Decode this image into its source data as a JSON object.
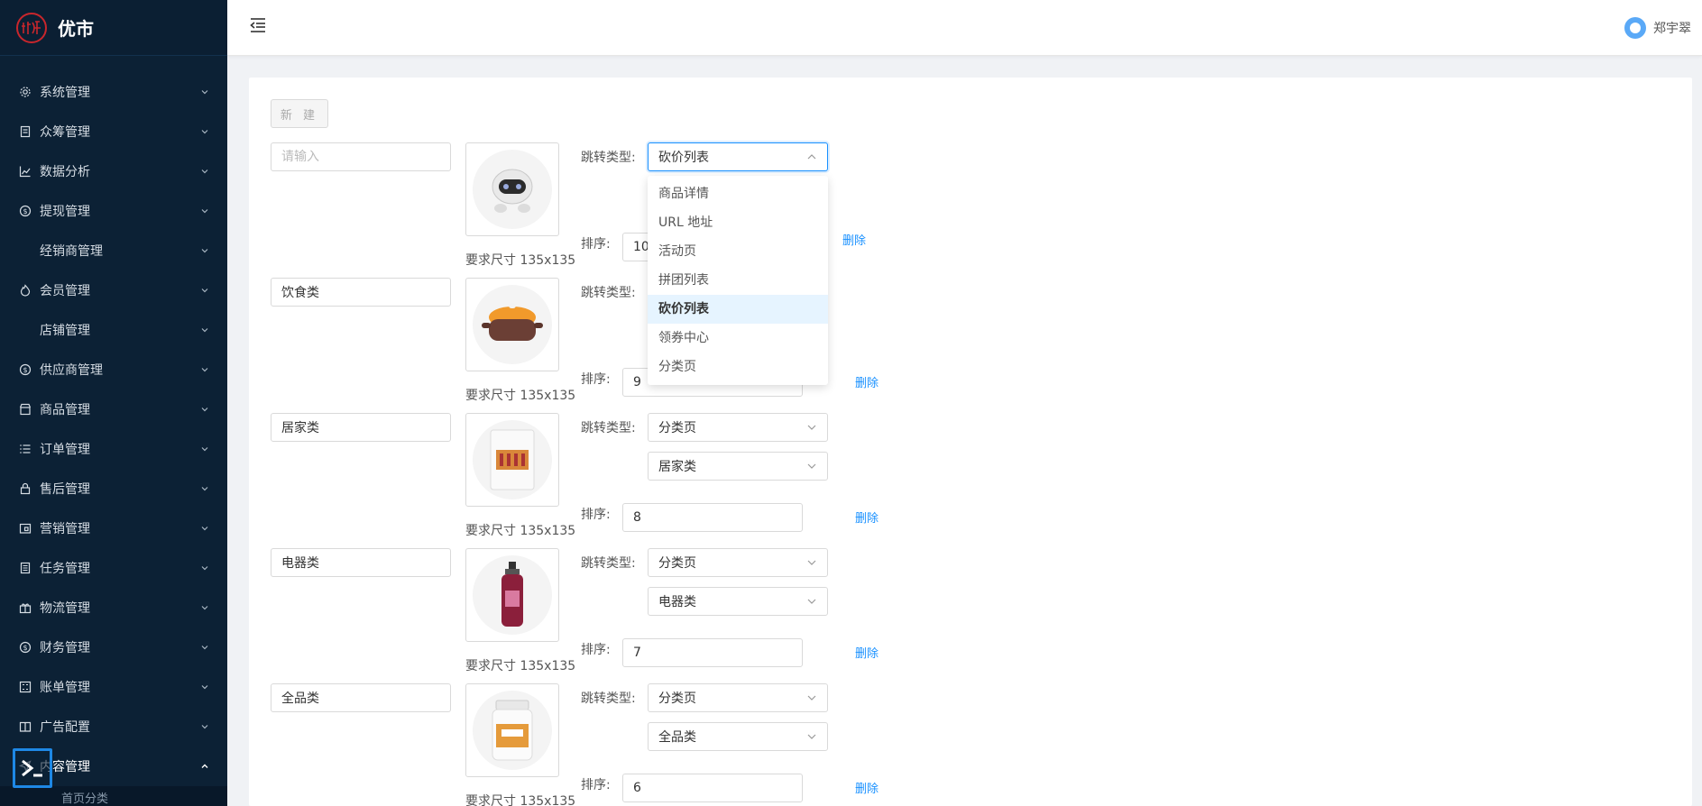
{
  "app": {
    "logo_text": "优市",
    "logo_mark": "优市"
  },
  "header": {
    "user_name": "郑宇翠"
  },
  "sidebar": {
    "items": [
      {
        "label": "系统管理",
        "icon": "gear-icon",
        "has_icon": true
      },
      {
        "label": "众筹管理",
        "icon": "clipboard-icon",
        "has_icon": true
      },
      {
        "label": "数据分析",
        "icon": "line-chart-icon",
        "has_icon": true
      },
      {
        "label": "提现管理",
        "icon": "coin-icon",
        "has_icon": true
      },
      {
        "label": "经销商管理",
        "icon": "",
        "has_icon": false
      },
      {
        "label": "会员管理",
        "icon": "fire-icon",
        "has_icon": true
      },
      {
        "label": "店铺管理",
        "icon": "",
        "has_icon": false
      },
      {
        "label": "供应商管理",
        "icon": "coin-icon",
        "has_icon": true
      },
      {
        "label": "商品管理",
        "icon": "shop-icon",
        "has_icon": true
      },
      {
        "label": "订单管理",
        "icon": "list-icon",
        "has_icon": true
      },
      {
        "label": "售后管理",
        "icon": "lock-icon",
        "has_icon": true
      },
      {
        "label": "营销管理",
        "icon": "share-box-icon",
        "has_icon": true
      },
      {
        "label": "任务管理",
        "icon": "document-icon",
        "has_icon": true
      },
      {
        "label": "物流管理",
        "icon": "gift-icon",
        "has_icon": true
      },
      {
        "label": "财务管理",
        "icon": "coin-icon",
        "has_icon": true
      },
      {
        "label": "账单管理",
        "icon": "calculator-icon",
        "has_icon": true
      },
      {
        "label": "广告配置",
        "icon": "book-icon",
        "has_icon": true
      },
      {
        "label": "内容管理",
        "icon": "send-icon",
        "has_icon": true,
        "expanded": true
      }
    ],
    "sub_item": "首页分类"
  },
  "toolbar": {
    "new_label": "新 建"
  },
  "form": {
    "placeholder": "请输入",
    "size_hint": "要求尺寸 135x135",
    "jump_label": "跳转类型:",
    "sort_label": "排序:",
    "delete_label": "删除",
    "rows": [
      {
        "name": "",
        "jump_type": "砍价列表",
        "sort": "10",
        "product": "robot"
      },
      {
        "name": "饮食类",
        "jump_type": "",
        "sort": "9",
        "product": "pot"
      },
      {
        "name": "居家类",
        "jump_type": "分类页",
        "category": "居家类",
        "sort": "8",
        "product": "box"
      },
      {
        "name": "电器类",
        "jump_type": "分类页",
        "category": "电器类",
        "sort": "7",
        "product": "bottle"
      },
      {
        "name": "全品类",
        "jump_type": "分类页",
        "category": "全品类",
        "sort": "6",
        "product": "jar"
      }
    ]
  },
  "dropdown": {
    "options": [
      "商品详情",
      "URL 地址",
      "活动页",
      "拼团列表",
      "砍价列表",
      "领券中心",
      "分类页"
    ],
    "selected": "砍价列表"
  },
  "colors": {
    "sidebar_bg": "#0c2135",
    "accent": "#1890ff",
    "brand_red": "#c8262c"
  }
}
